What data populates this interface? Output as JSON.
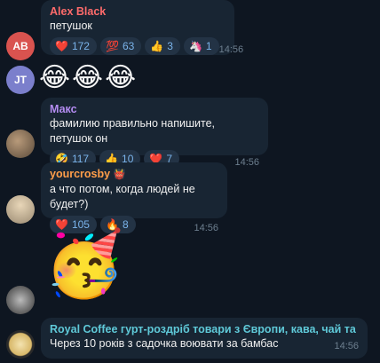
{
  "messages": [
    {
      "avatar_initials": "AB",
      "avatar_color": "#d9534f",
      "sender": "Alex Black",
      "sender_color": "#ff6b6b",
      "text": "петушок",
      "reactions": [
        {
          "emoji": "❤️",
          "count": "172"
        },
        {
          "emoji": "💯",
          "count": "63"
        },
        {
          "emoji": "👍",
          "count": "3"
        },
        {
          "emoji": "🦄",
          "count": "1"
        }
      ],
      "time": "14:56"
    },
    {
      "avatar_initials": "JT",
      "avatar_color": "#7b7fcc",
      "emoji_text": "😂😂😂"
    },
    {
      "sender": "Макс",
      "sender_color": "#b48cf2",
      "text": "фамилию правильно напишите, петушок он",
      "reactions": [
        {
          "emoji": "🤣",
          "count": "117"
        },
        {
          "emoji": "👍",
          "count": "10"
        },
        {
          "emoji": "❤️",
          "count": "7"
        }
      ],
      "time": "14:56"
    },
    {
      "sender": "yourcrosby",
      "sender_badge": "👹",
      "sender_color": "#ff9e4a",
      "text": "а что потом, когда людей не будет?)",
      "reactions": [
        {
          "emoji": "❤️",
          "count": "105"
        },
        {
          "emoji": "🔥",
          "count": "8"
        }
      ],
      "time": "14:56"
    },
    {
      "big_emoji": "🥳"
    },
    {
      "sender": "Royal Coffee гурт-роздріб товари з Європи, кава, чай та спеції",
      "sender_color": "#5fc9d8",
      "text": "Через 10 років з садочка воювати за бамбас",
      "time": "14:56"
    }
  ]
}
